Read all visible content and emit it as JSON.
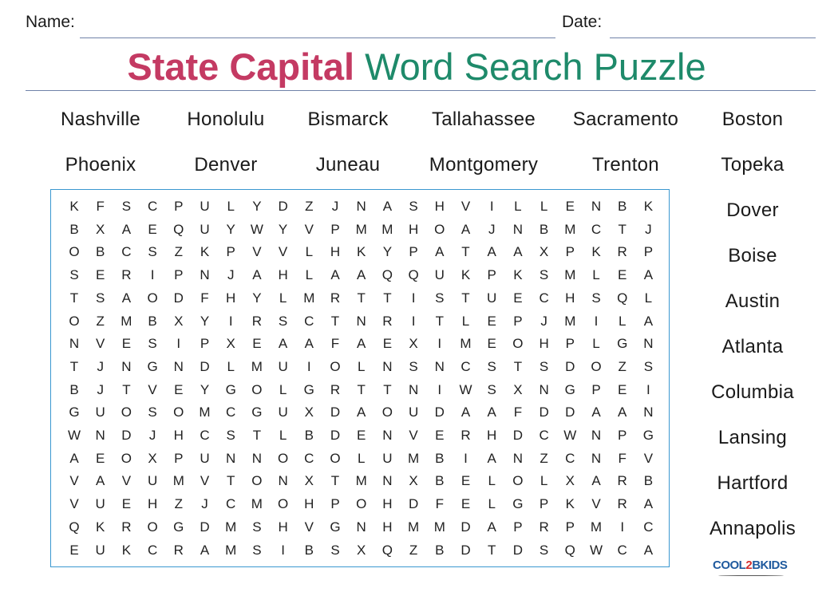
{
  "header": {
    "name_label": "Name:",
    "date_label": "Date:",
    "title_part1": "State Capital",
    "title_part2": "Word Search Puzzle",
    "colors": {
      "title_part1": "#c43a63",
      "title_part2": "#1e8a6a",
      "grid_border": "#3a98d0",
      "rule": "#6f82a8"
    }
  },
  "word_list": {
    "row1": [
      "Nashville",
      "Honolulu",
      "Bismarck",
      "Tallahassee",
      "Sacramento",
      "Boston"
    ],
    "row2": [
      "Phoenix",
      "Denver",
      "Juneau",
      "Montgomery",
      "Trenton",
      "Topeka"
    ],
    "side_column": [
      "Dover",
      "Boise",
      "Austin",
      "Atlanta",
      "Columbia",
      "Lansing",
      "Hartford",
      "Annapolis"
    ]
  },
  "grid": [
    "KFSCPULYDZJNASHVILLENBK",
    "BXAEQUYWYVPMMHOAJNBMCTJ",
    "OBCSZKPVVLHKYPATAAXPKRP",
    "SERIPNJAHLAAQQUKPKSMLEA",
    "TSAODFHYLMRTTISTUECHSQL",
    "OZMBXYIRSCTNRITLEPJMILA",
    "NVESIPXEAAFAEXIMEOHPLGN",
    "TJNGNDLMUIOLNSNCSTSDOZS",
    "BJTVEYGOLGRTTNIWSXNGPEI",
    "GUOSOMCGUXDAOUDAAFDDAAN",
    "WNDJHCSTLBDENVERHDCWNPG",
    "AEOXPUNNOCOLUMBIANZCNFV",
    "VAVUMVTONXTMNXBELOLXARB",
    "VUEHZJCMOHPOHDFELGPKVRA",
    "QKROGDMSHVGNHMMDAPRPMIC",
    "EUKCRAMSIBSXQZBDTDSQWCA"
  ],
  "logo": {
    "part1": "COOL",
    "part2": "2",
    "part3": "BKIDS"
  }
}
